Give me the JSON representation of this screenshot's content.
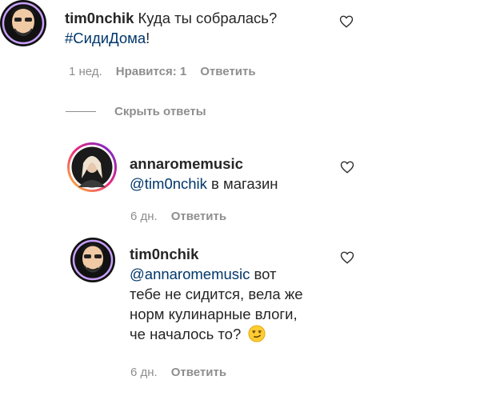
{
  "comments": {
    "main": {
      "username": "tim0nchik",
      "text": "Куда ты собралась?",
      "hashtag": "#СидиДома",
      "text_end": "!",
      "time": "1 нед.",
      "likes": "Нравится: 1",
      "reply_label": "Ответить"
    },
    "hide_replies_label": "Скрыть ответы",
    "reply1": {
      "username": "annaromemusic",
      "mention": "@tim0nchik",
      "text": " в магазин",
      "time": "6 дн.",
      "reply_label": "Ответить"
    },
    "reply2": {
      "username": "tim0nchik",
      "mention": "@annaromemusic",
      "line1": " вот",
      "line2": "тебе не сидится, вела же",
      "line3": "норм кулинарные влоги,",
      "line4": "че началось то?",
      "emoji": "smirking-face",
      "time": "6 дн.",
      "reply_label": "Ответить"
    }
  },
  "colors": {
    "text": "#262626",
    "secondary": "#8e8e8e",
    "link": "#00376b",
    "story_ring": "#d6249f"
  }
}
